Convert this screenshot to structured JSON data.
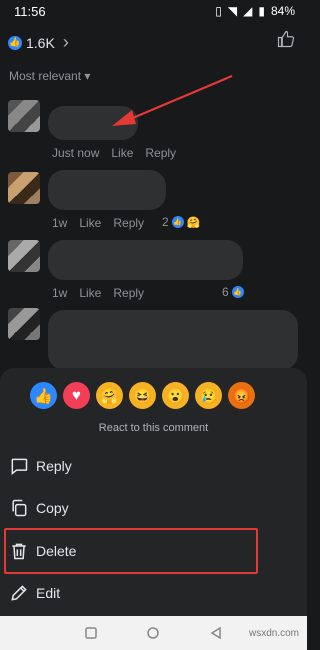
{
  "status": {
    "time": "11:56",
    "battery": "84%"
  },
  "post": {
    "like_count": "1.6K",
    "chevron": "›"
  },
  "sort": {
    "label": "Most relevant"
  },
  "comments": [
    {
      "time": "Just now",
      "like": "Like",
      "reply": "Reply",
      "reaction_count": ""
    },
    {
      "time": "1w",
      "like": "Like",
      "reply": "Reply",
      "reaction_count": "2"
    },
    {
      "time": "1w",
      "like": "Like",
      "reply": "Reply",
      "reaction_count": "6"
    }
  ],
  "reactions": {
    "caption": "React to this comment",
    "items": [
      "like",
      "love",
      "care",
      "haha",
      "wow",
      "sad",
      "angry"
    ]
  },
  "menu": {
    "reply": "Reply",
    "copy": "Copy",
    "delete": "Delete",
    "edit": "Edit"
  },
  "colors": {
    "highlight": "#e53935",
    "like_blue": "#2d88ff",
    "love_red": "#f33e58"
  }
}
